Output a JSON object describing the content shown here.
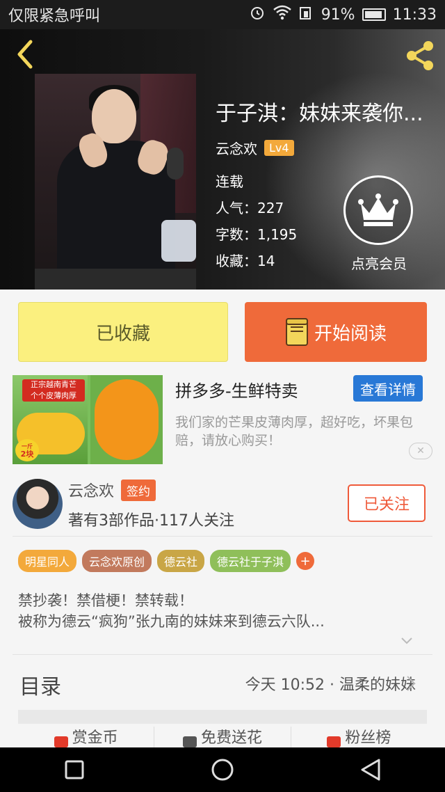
{
  "status_bar": {
    "carrier": "仅限紧急呼叫",
    "battery": "91%",
    "time": "11:33"
  },
  "hero": {
    "title": "于子淇：妹妹来袭你...",
    "author": "云念欢",
    "level": "Lv4",
    "status": "连载",
    "popularity_label": "人气：",
    "popularity": "227",
    "words_label": "字数：",
    "words": "1,195",
    "favorites_label": "收藏：",
    "favorites": "14",
    "vip_label": "点亮会员"
  },
  "actions": {
    "collected": "已收藏",
    "start_read": "开始阅读"
  },
  "ad": {
    "banner_line1": "正宗越南青芒",
    "banner_line2": "个个皮薄肉厚",
    "price_top": "一斤",
    "price": "2块",
    "title": "拼多多-生鲜特卖",
    "detail_button": "查看详情",
    "description": "我们家的芒果皮薄肉厚，超好吃，坏果包赔，请放心购买！"
  },
  "author_card": {
    "name": "云念欢",
    "badge": "签约",
    "stats": "著有3部作品·117人关注",
    "follow_button": "已关注"
  },
  "tags": [
    {
      "label": "明星同人",
      "color": "#f3a93b"
    },
    {
      "label": "云念欢原创",
      "color": "#c27a5d"
    },
    {
      "label": "德云社",
      "color": "#c9a646"
    },
    {
      "label": "德云社于子淇",
      "color": "#8fbf5a"
    }
  ],
  "tag_add": "+",
  "intro": {
    "line1": "禁抄袭！禁借梗！禁转载！",
    "line2": "被称为德云“疯狗”张九南的妹妹来到德云六队..."
  },
  "toc": {
    "label": "目录",
    "latest": "今天 10:52 · 温柔的妹妹"
  },
  "bottom_tabs": [
    {
      "label": "赏金币",
      "icon": "gift-icon",
      "color": "#e23a2a"
    },
    {
      "label": "免费送花",
      "icon": "flower-icon",
      "color": "#555555"
    },
    {
      "label": "粉丝榜",
      "icon": "fans-icon",
      "color": "#e23a2a"
    }
  ],
  "colors": {
    "accent": "#ef6a3a",
    "collected_bg": "#fbf07f",
    "link_blue": "#2878d6",
    "icon_yellow": "#f3d65b"
  }
}
